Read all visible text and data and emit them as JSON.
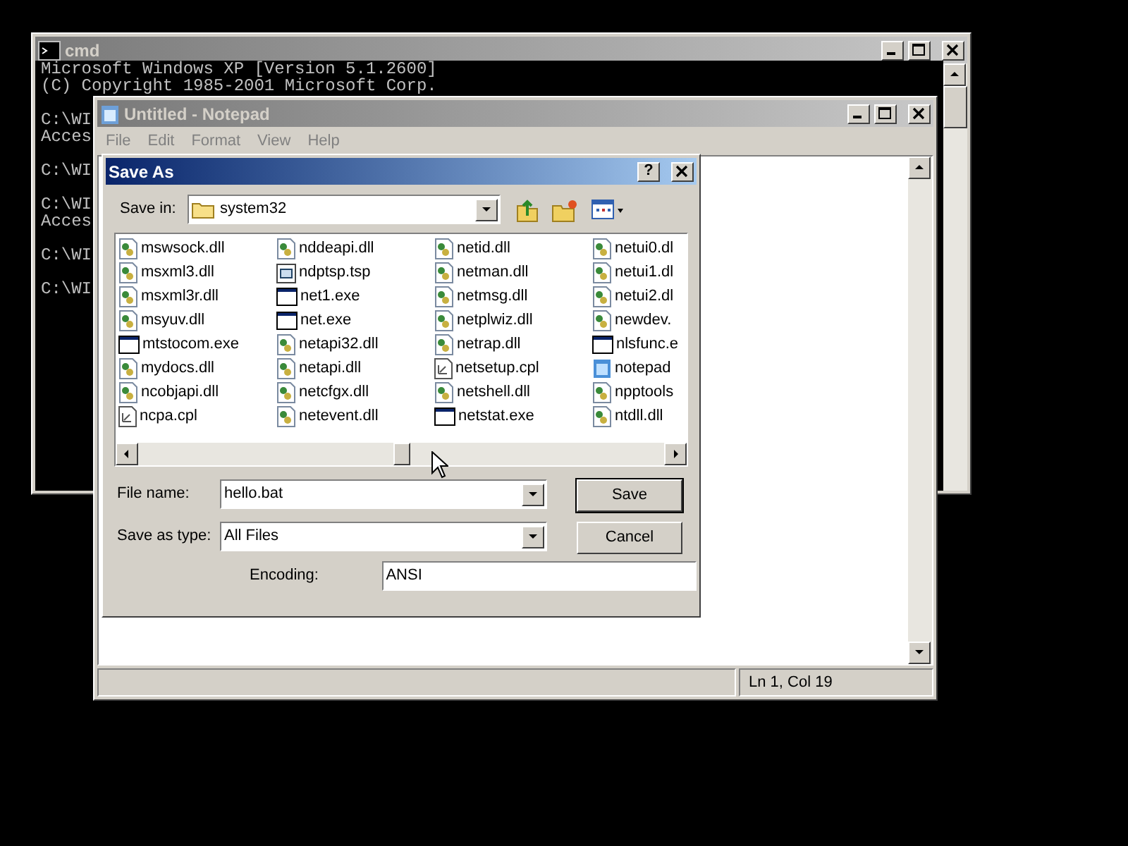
{
  "cmd_window": {
    "title": "cmd",
    "active": false,
    "blocks": [
      [
        "Microsoft Windows XP [Version 5.1.2600]",
        "(C) Copyright 1985-2001 Microsoft Corp."
      ],
      [
        "C:\\WI",
        "Acces"
      ],
      [
        "C:\\WI"
      ],
      [
        "C:\\WI",
        "Acces"
      ],
      [
        "C:\\WI"
      ],
      [
        "C:\\WI"
      ]
    ]
  },
  "notepad_window": {
    "title": "Untitled - Notepad",
    "active": false,
    "menu": [
      "File",
      "Edit",
      "Format",
      "View",
      "Help"
    ],
    "status_bar": "Ln 1, Col 19"
  },
  "save_dialog": {
    "title": "Save As",
    "active": true,
    "help_button": "?",
    "save_in_label": "Save in:",
    "save_in_value": "system32",
    "file_columns": [
      [
        {
          "name": "mswsock.dll",
          "kind": "dll"
        },
        {
          "name": "msxml3.dll",
          "kind": "dll"
        },
        {
          "name": "msxml3r.dll",
          "kind": "dll"
        },
        {
          "name": "msyuv.dll",
          "kind": "dll"
        },
        {
          "name": "mtstocom.exe",
          "kind": "exe"
        },
        {
          "name": "mydocs.dll",
          "kind": "dll"
        },
        {
          "name": "ncobjapi.dll",
          "kind": "dll"
        },
        {
          "name": "ncpa.cpl",
          "kind": "cpl"
        }
      ],
      [
        {
          "name": "nddeapi.dll",
          "kind": "dll"
        },
        {
          "name": "ndptsp.tsp",
          "kind": "tsp"
        },
        {
          "name": "net1.exe",
          "kind": "exe"
        },
        {
          "name": "net.exe",
          "kind": "exe"
        },
        {
          "name": "netapi32.dll",
          "kind": "dll"
        },
        {
          "name": "netapi.dll",
          "kind": "dll"
        },
        {
          "name": "netcfgx.dll",
          "kind": "dll"
        },
        {
          "name": "netevent.dll",
          "kind": "dll"
        }
      ],
      [
        {
          "name": "netid.dll",
          "kind": "dll"
        },
        {
          "name": "netman.dll",
          "kind": "dll"
        },
        {
          "name": "netmsg.dll",
          "kind": "dll"
        },
        {
          "name": "netplwiz.dll",
          "kind": "dll"
        },
        {
          "name": "netrap.dll",
          "kind": "dll"
        },
        {
          "name": "netsetup.cpl",
          "kind": "cpl"
        },
        {
          "name": "netshell.dll",
          "kind": "dll"
        },
        {
          "name": "netstat.exe",
          "kind": "exe"
        }
      ],
      [
        {
          "name": "netui0.dl",
          "kind": "dll"
        },
        {
          "name": "netui1.dl",
          "kind": "dll"
        },
        {
          "name": "netui2.dl",
          "kind": "dll"
        },
        {
          "name": "newdev.",
          "kind": "dll"
        },
        {
          "name": "nlsfunc.e",
          "kind": "exe"
        },
        {
          "name": "notepad",
          "kind": "notepad"
        },
        {
          "name": "npptools",
          "kind": "dll"
        },
        {
          "name": "ntdll.dll",
          "kind": "dll"
        }
      ]
    ],
    "file_name_label": "File name:",
    "file_name_value": "hello.bat",
    "type_label": "Save as type:",
    "type_value": "All Files",
    "encoding_label": "Encoding:",
    "encoding_value": "ANSI",
    "buttons": [
      "Save",
      "Cancel"
    ]
  }
}
